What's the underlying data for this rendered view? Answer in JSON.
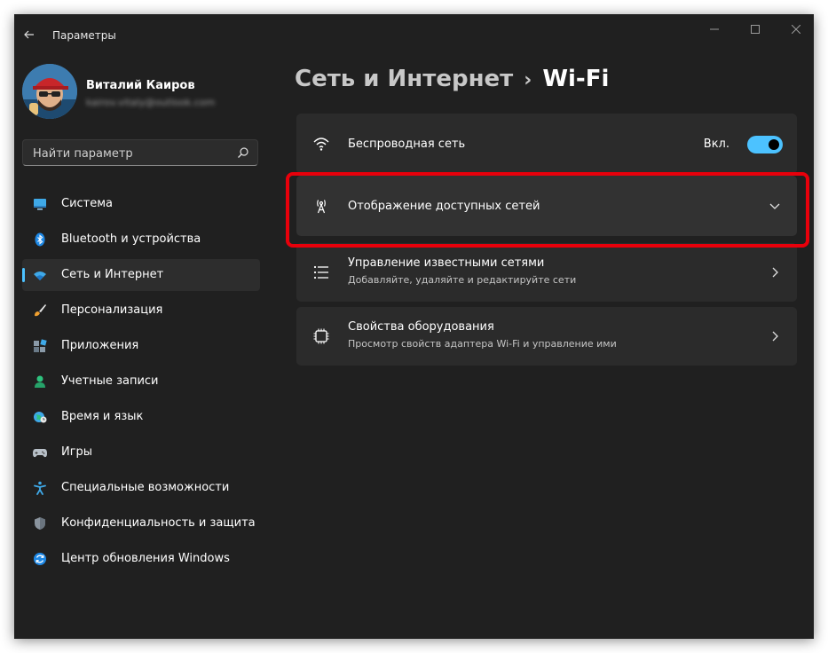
{
  "window": {
    "title": "Параметры"
  },
  "user": {
    "name": "Виталий Каиров",
    "email": "kairov.vitaly@outlook.com"
  },
  "search": {
    "placeholder": "Найти параметр"
  },
  "nav": {
    "items": [
      {
        "label": "Система",
        "icon": "display-icon",
        "selected": false
      },
      {
        "label": "Bluetooth и устройства",
        "icon": "bluetooth-icon",
        "selected": false
      },
      {
        "label": "Сеть и Интернет",
        "icon": "wifi-icon",
        "selected": true
      },
      {
        "label": "Персонализация",
        "icon": "brush-icon",
        "selected": false
      },
      {
        "label": "Приложения",
        "icon": "apps-icon",
        "selected": false
      },
      {
        "label": "Учетные записи",
        "icon": "person-icon",
        "selected": false
      },
      {
        "label": "Время и язык",
        "icon": "globe-clock-icon",
        "selected": false
      },
      {
        "label": "Игры",
        "icon": "gamepad-icon",
        "selected": false
      },
      {
        "label": "Специальные возможности",
        "icon": "accessibility-icon",
        "selected": false
      },
      {
        "label": "Конфиденциальность и защита",
        "icon": "shield-icon",
        "selected": false
      },
      {
        "label": "Центр обновления Windows",
        "icon": "update-icon",
        "selected": false
      }
    ]
  },
  "breadcrumb": {
    "parent": "Сеть и Интернет",
    "separator": "›",
    "current": "Wi-Fi"
  },
  "cards": {
    "wireless": {
      "title": "Беспроводная сеть",
      "toggle_label": "Вкл.",
      "toggle_on": true
    },
    "available": {
      "title": "Отображение доступных сетей"
    },
    "known": {
      "title": "Управление известными сетями",
      "subtitle": "Добавляйте, удаляйте и редактируйте сети"
    },
    "hardware": {
      "title": "Свойства оборудования",
      "subtitle": "Просмотр свойств адаптера Wi-Fi и управление ими"
    }
  },
  "colors": {
    "accent": "#4cc2ff",
    "highlight": "#e8000b",
    "background": "#202020",
    "card": "#2b2b2b"
  }
}
